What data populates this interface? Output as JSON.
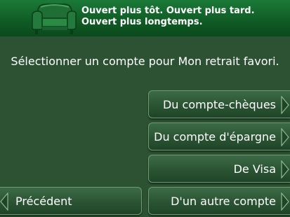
{
  "banner": {
    "slogan_line1": "Ouvert plus tôt.  Ouvert plus tard.",
    "slogan_line2": "Ouvert plus longtemps."
  },
  "prompt": "Sélectionner un compte pour Mon retrait favori.",
  "buttons": {
    "chequing": "Du compte-chèques",
    "savings": "Du compte d'épargne",
    "visa": "De Visa",
    "other": "D'un autre compte",
    "previous": "Précédent"
  },
  "colors": {
    "background": "#2d5233",
    "banner": "#0f5a24",
    "button_border": "#6b9a73",
    "text": "#ffffff"
  }
}
